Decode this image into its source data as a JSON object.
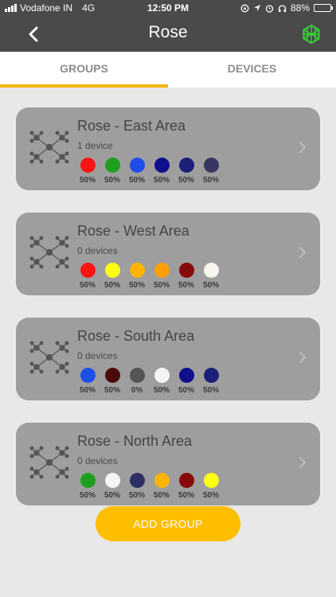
{
  "status": {
    "carrier": "Vodafone IN",
    "network": "4G",
    "time": "12:50 PM",
    "battery": "88%",
    "battery_level": 0.88
  },
  "nav": {
    "title": "Rose",
    "back_icon": "chevron-left-icon",
    "network_icon": "mesh-network-icon"
  },
  "tabs": [
    {
      "label": "GROUPS",
      "active": true
    },
    {
      "label": "DEVICES",
      "active": false
    }
  ],
  "groups": [
    {
      "name": "Rose - East Area",
      "devices": "1 device",
      "colors": [
        {
          "hex": "#ff1414",
          "pct": "50%"
        },
        {
          "hex": "#1ea01e",
          "pct": "50%"
        },
        {
          "hex": "#1d4fe8",
          "pct": "50%"
        },
        {
          "hex": "#0f0f8c",
          "pct": "50%"
        },
        {
          "hex": "#1b1f78",
          "pct": "50%"
        },
        {
          "hex": "#36355f",
          "pct": "50%"
        }
      ]
    },
    {
      "name": "Rose - West Area",
      "devices": "0 devices",
      "colors": [
        {
          "hex": "#ff1414",
          "pct": "50%"
        },
        {
          "hex": "#ffff14",
          "pct": "50%"
        },
        {
          "hex": "#ffb400",
          "pct": "50%"
        },
        {
          "hex": "#ffa000",
          "pct": "50%"
        },
        {
          "hex": "#870a0a",
          "pct": "50%"
        },
        {
          "hex": "#f8f6ee",
          "pct": "50%"
        }
      ]
    },
    {
      "name": "Rose - South Area",
      "devices": "0 devices",
      "colors": [
        {
          "hex": "#1d4fe8",
          "pct": "50%"
        },
        {
          "hex": "#4a0a0a",
          "pct": "50%"
        },
        {
          "hex": "#555555",
          "pct": "0%"
        },
        {
          "hex": "#f5f5f5",
          "pct": "50%"
        },
        {
          "hex": "#0f0f8c",
          "pct": "50%"
        },
        {
          "hex": "#1b1f78",
          "pct": "50%"
        }
      ]
    },
    {
      "name": "Rose - North Area",
      "devices": "0 devices",
      "colors": [
        {
          "hex": "#1ea01e",
          "pct": "50%"
        },
        {
          "hex": "#f5f5f5",
          "pct": "50%"
        },
        {
          "hex": "#2e2f62",
          "pct": "50%"
        },
        {
          "hex": "#ffb400",
          "pct": "50%"
        },
        {
          "hex": "#870a0a",
          "pct": "50%"
        },
        {
          "hex": "#ffff14",
          "pct": "50%"
        }
      ]
    }
  ],
  "add_button": "ADD GROUP",
  "accent": "#ffbe00"
}
